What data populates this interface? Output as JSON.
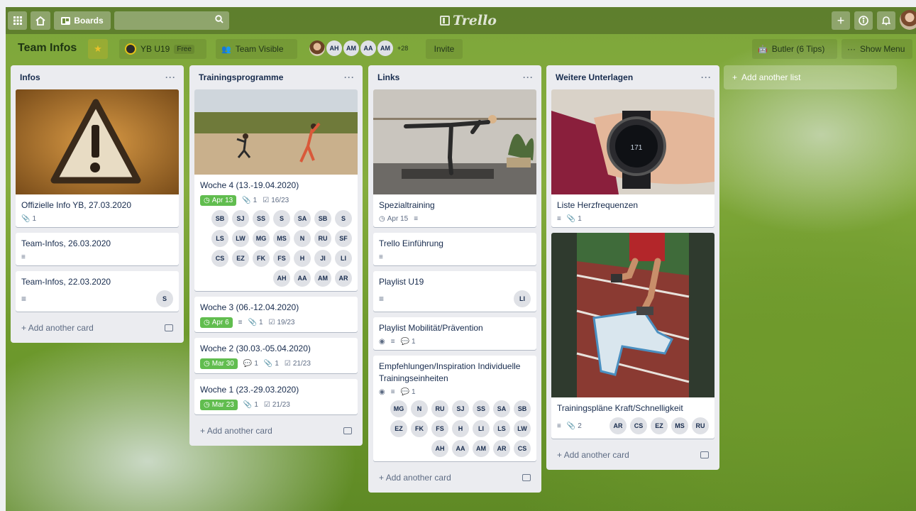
{
  "topbar": {
    "boards_label": "Boards",
    "logo_text": "Trello"
  },
  "board": {
    "title": "Team Infos",
    "team_label": "YB U19",
    "team_plan": "Free",
    "visibility": "Team Visible",
    "members": [
      "AH",
      "AM",
      "AA",
      "AM"
    ],
    "more_members": "+28",
    "invite": "Invite",
    "butler": "Butler (6 Tips)",
    "show_menu": "Show Menu"
  },
  "common": {
    "add_card": "Add another card",
    "add_list": "Add another list",
    "list_menu": "···"
  },
  "lists": [
    {
      "title": "Infos",
      "cards": [
        {
          "title": "Offizielle Info YB, 27.03.2020",
          "attachments": "1"
        },
        {
          "title": "Team-Infos, 26.03.2020"
        },
        {
          "title": "Team-Infos, 22.03.2020",
          "members": [
            "S"
          ]
        }
      ]
    },
    {
      "title": "Trainingsprogramme",
      "cards": [
        {
          "title": "Woche 4 (13.-19.04.2020)",
          "due": "Apr 13",
          "attachments": "1",
          "checklist": "16/23",
          "members": [
            "SB",
            "SJ",
            "SS",
            "S",
            "SA",
            "SB",
            "S",
            "LS",
            "LW",
            "MG",
            "MS",
            "N",
            "RU",
            "SF",
            "CS",
            "EZ",
            "FK",
            "FS",
            "H",
            "JI",
            "LI",
            "AH",
            "AA",
            "AM",
            "AR"
          ]
        },
        {
          "title": "Woche 3 (06.-12.04.2020)",
          "due": "Apr 6",
          "attachments": "1",
          "checklist": "19/23"
        },
        {
          "title": "Woche 2 (30.03.-05.04.2020)",
          "due": "Mar 30",
          "comments": "1",
          "attachments": "1",
          "checklist": "21/23"
        },
        {
          "title": "Woche 1 (23.-29.03.2020)",
          "due": "Mar 23",
          "attachments": "1",
          "checklist": "21/23"
        }
      ]
    },
    {
      "title": "Links",
      "cards": [
        {
          "title": "Spezialtraining",
          "due": "Apr 15"
        },
        {
          "title": "Trello Einführung"
        },
        {
          "title": "Playlist U19",
          "members": [
            "LI"
          ]
        },
        {
          "title": "Playlist Mobilität/Prävention",
          "comments": "1"
        },
        {
          "title": "Empfehlungen/Inspiration Individuelle Trainingseinheiten",
          "comments": "1",
          "members": [
            "MG",
            "N",
            "RU",
            "SJ",
            "SS",
            "SA",
            "SB",
            "EZ",
            "FK",
            "FS",
            "H",
            "LI",
            "LS",
            "LW",
            "AH",
            "AA",
            "AM",
            "AR",
            "CS"
          ]
        }
      ]
    },
    {
      "title": "Weitere Unterlagen",
      "cards": [
        {
          "title": "Liste Herzfrequenzen",
          "attachments": "1",
          "watch_display": "171"
        },
        {
          "title": "Trainingspläne Kraft/Schnelligkeit",
          "attachments": "2",
          "members": [
            "AR",
            "CS",
            "EZ",
            "MS",
            "RU"
          ]
        }
      ]
    }
  ],
  "colors": {
    "due_green": "#61bd4f",
    "list_bg": "#ebecf0",
    "topbar": "#46602a"
  }
}
